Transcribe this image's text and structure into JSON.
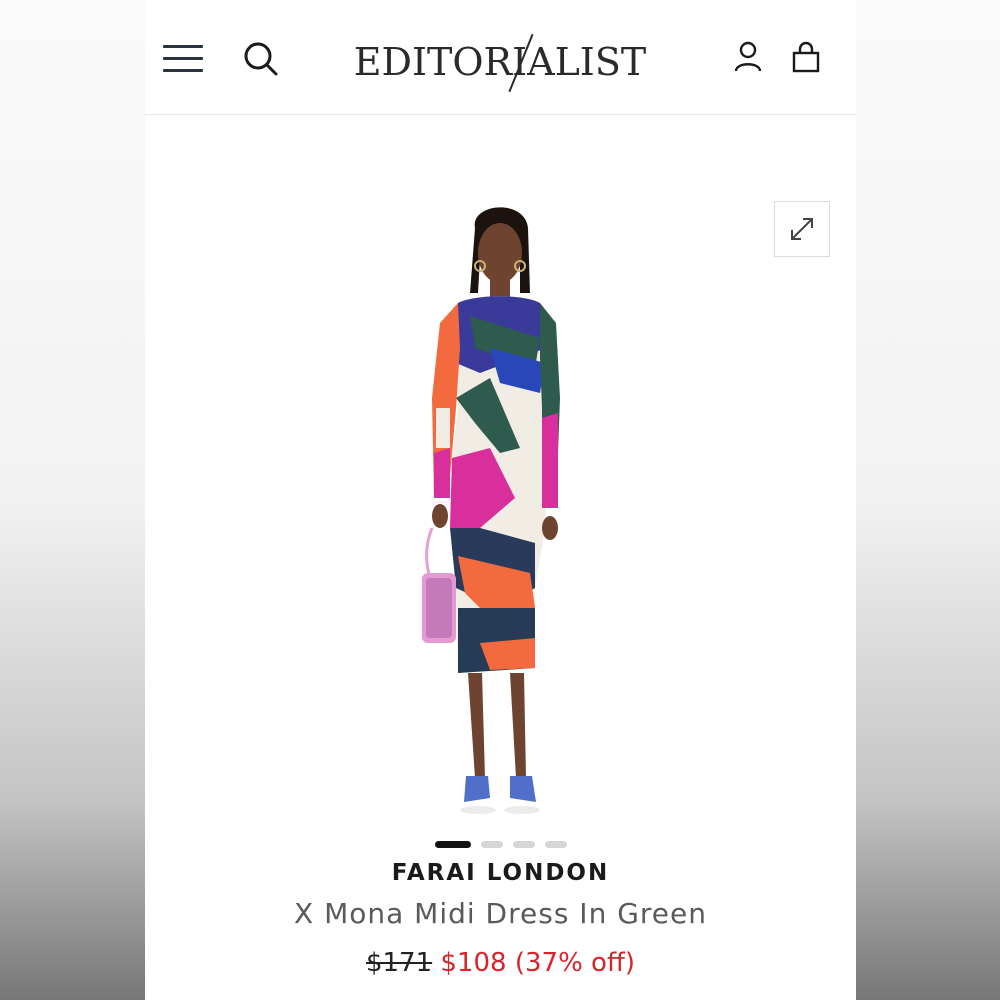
{
  "header": {
    "logo_text": "EDITORIALIST",
    "icons": [
      "menu-icon",
      "search-icon",
      "account-icon",
      "shopping-bag-icon"
    ]
  },
  "gallery": {
    "expand_icon": "expand-icon",
    "image_count": 4,
    "active_image": 1
  },
  "product": {
    "brand": "FARAI LONDON",
    "name": "X Mona Midi Dress In Green",
    "original_price": "$171",
    "sale_price": "$108",
    "discount": "(37% off)"
  },
  "colors": {
    "sale": "#d8232a",
    "text": "#1a1a1a",
    "muted": "#5a5a5a"
  }
}
